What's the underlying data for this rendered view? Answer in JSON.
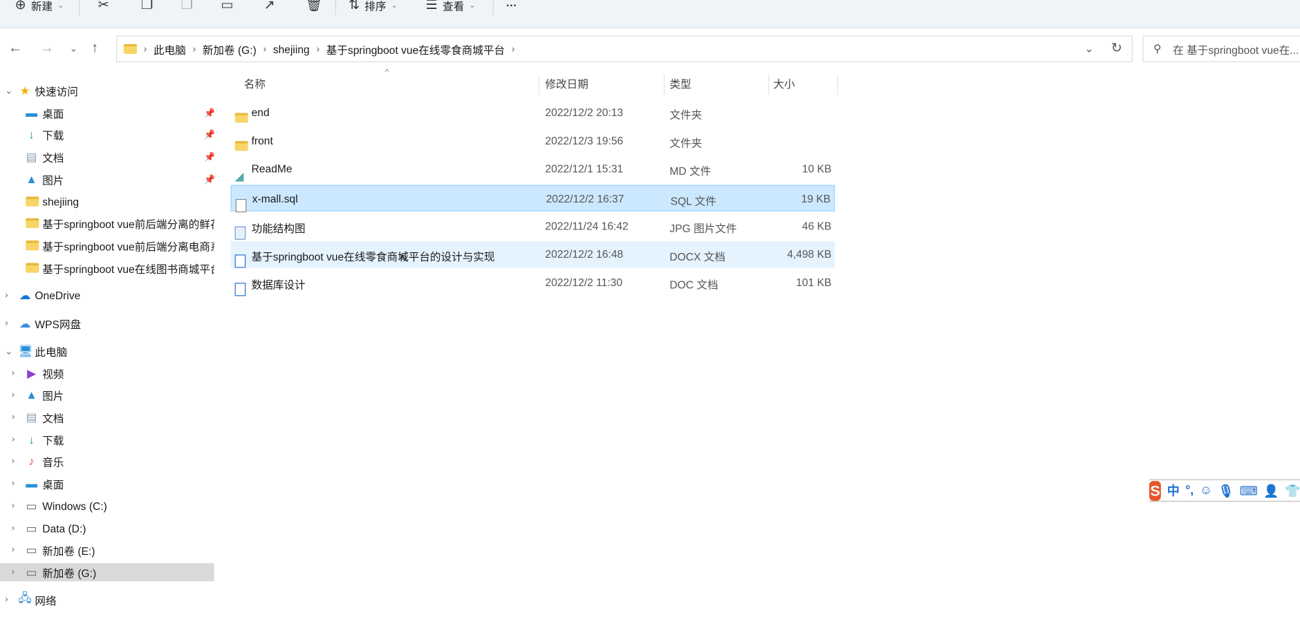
{
  "toolbar": {
    "new_label": "新建",
    "sort_label": "排序",
    "view_label": "查看",
    "more": "···"
  },
  "address": {
    "crumbs": [
      "此电脑",
      "新加卷 (G:)",
      "shejiing",
      "基于springboot vue在线零食商城平台"
    ]
  },
  "search": {
    "placeholder": "在 基于springboot vue在..."
  },
  "sidebar": {
    "quick_access": "快速访问",
    "quick": [
      "桌面",
      "下载",
      "文档",
      "图片",
      "shejiing",
      "基于springboot vue前后端分离的鲜花",
      "基于springboot vue前后端分离电商系统",
      "基于springboot vue在线图书商城平台"
    ],
    "onedrive": "OneDrive",
    "wps": "WPS网盘",
    "this_pc": "此电脑",
    "pc": [
      "视频",
      "图片",
      "文档",
      "下载",
      "音乐",
      "桌面",
      "Windows (C:)",
      "Data (D:)",
      "新加卷 (E:)",
      "新加卷 (G:)"
    ],
    "network": "网络"
  },
  "columns": {
    "name": "名称",
    "date": "修改日期",
    "type": "类型",
    "size": "大小"
  },
  "files": [
    {
      "name": "end",
      "date": "2022/12/2 20:13",
      "type": "文件夹",
      "size": ""
    },
    {
      "name": "front",
      "date": "2022/12/3 19:56",
      "type": "文件夹",
      "size": ""
    },
    {
      "name": "ReadMe",
      "date": "2022/12/1 15:31",
      "type": "MD 文件",
      "size": "10 KB"
    },
    {
      "name": "x-mall.sql",
      "date": "2022/12/2 16:37",
      "type": "SQL 文件",
      "size": "19 KB"
    },
    {
      "name": "功能结构图",
      "date": "2022/11/24 16:42",
      "type": "JPG 图片文件",
      "size": "46 KB"
    },
    {
      "name": "基于springboot vue在线零食商城平台的设计与实现",
      "date": "2022/12/2 16:48",
      "type": "DOCX 文档",
      "size": "4,498 KB"
    },
    {
      "name": "数据库设计",
      "date": "2022/12/2 11:30",
      "type": "DOC 文档",
      "size": "101 KB"
    }
  ],
  "ime": {
    "logo": "S",
    "mode": "中",
    "punct": "°,"
  }
}
